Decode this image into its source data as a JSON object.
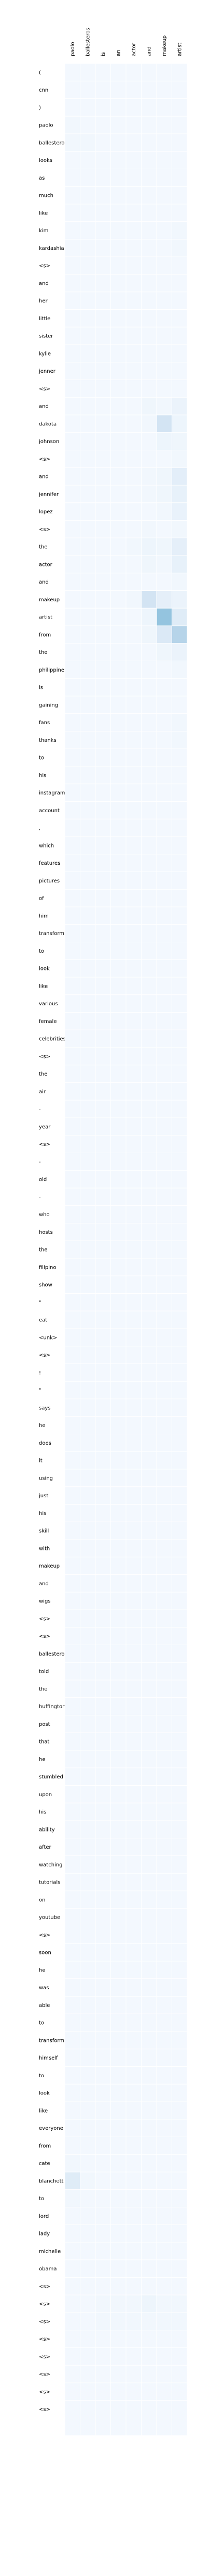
{
  "chart_data": {
    "type": "heatmap",
    "title": "",
    "xlabel": "",
    "ylabel": "",
    "x_labels": [
      "paolo",
      "ballesteros",
      "is",
      "an",
      "actor",
      "and",
      "makeup",
      "artist"
    ],
    "y_labels": [
      "(",
      "cnn",
      ")",
      "paolo",
      "ballesteros",
      "looks",
      "as",
      "much",
      "like",
      "kim",
      "kardashian",
      "<s>",
      "and",
      "her",
      "little",
      "sister",
      "kylie",
      "jenner",
      "<s>",
      "and",
      "dakota",
      "johnson",
      "<s>",
      "and",
      "jennifer",
      "lopez",
      "<s>",
      "the",
      "actor",
      "and",
      "makeup",
      "artist",
      "from",
      "the",
      "philippines",
      "is",
      "gaining",
      "fans",
      "thanks",
      "to",
      "his",
      "instagram",
      "account",
      ",",
      "which",
      "features",
      "pictures",
      "of",
      "him",
      "transformed",
      "to",
      "look",
      "like",
      "various",
      "female",
      "celebrities",
      "<s>",
      "the",
      "air",
      "-",
      "year",
      "<s>",
      "-",
      "old",
      "-",
      "who",
      "hosts",
      "the",
      "filipino",
      "show",
      "\"",
      "eat",
      "<unk>",
      "<s>",
      "!",
      "\"",
      "says",
      "he",
      "does",
      "it",
      "using",
      "just",
      "his",
      "skill",
      "with",
      "makeup",
      "and",
      "wigs",
      "<s>",
      "<s>",
      "ballesteros",
      "told",
      "the",
      "huffington",
      "post",
      "that",
      "he",
      "stumbled",
      "upon",
      "his",
      "ability",
      "after",
      "watching",
      "tutorials",
      "on",
      "youtube",
      "<s>",
      "soon",
      "he",
      "was",
      "able",
      "to",
      "transform",
      "himself",
      "to",
      "look",
      "like",
      "everyone",
      "from",
      "cate",
      "blanchett",
      "to",
      "lord",
      "lady",
      "michelle",
      "obama",
      "<s>",
      "<s>",
      "<s>",
      "<s>",
      "<s>",
      "<s>",
      "<s>",
      "<s>"
    ],
    "values": [
      [
        0.02,
        0.02,
        0.02,
        0.02,
        0.02,
        0.02,
        0.02,
        0.02
      ],
      [
        0.02,
        0.02,
        0.02,
        0.02,
        0.02,
        0.02,
        0.02,
        0.02
      ],
      [
        0.02,
        0.02,
        0.02,
        0.02,
        0.02,
        0.02,
        0.02,
        0.02
      ],
      [
        0.03,
        0.02,
        0.02,
        0.02,
        0.02,
        0.02,
        0.02,
        0.02
      ],
      [
        0.03,
        0.03,
        0.02,
        0.02,
        0.02,
        0.02,
        0.02,
        0.02
      ],
      [
        0.02,
        0.02,
        0.02,
        0.02,
        0.02,
        0.02,
        0.02,
        0.02
      ],
      [
        0.02,
        0.02,
        0.02,
        0.02,
        0.02,
        0.02,
        0.02,
        0.02
      ],
      [
        0.02,
        0.02,
        0.02,
        0.02,
        0.02,
        0.02,
        0.02,
        0.02
      ],
      [
        0.02,
        0.02,
        0.02,
        0.02,
        0.02,
        0.02,
        0.02,
        0.02
      ],
      [
        0.02,
        0.02,
        0.02,
        0.02,
        0.02,
        0.02,
        0.02,
        0.03
      ],
      [
        0.02,
        0.02,
        0.02,
        0.02,
        0.02,
        0.02,
        0.02,
        0.03
      ],
      [
        0.02,
        0.02,
        0.02,
        0.02,
        0.02,
        0.02,
        0.02,
        0.02
      ],
      [
        0.02,
        0.02,
        0.02,
        0.02,
        0.02,
        0.02,
        0.02,
        0.02
      ],
      [
        0.02,
        0.02,
        0.02,
        0.02,
        0.02,
        0.02,
        0.02,
        0.02
      ],
      [
        0.02,
        0.02,
        0.02,
        0.02,
        0.02,
        0.02,
        0.02,
        0.02
      ],
      [
        0.02,
        0.02,
        0.02,
        0.02,
        0.02,
        0.02,
        0.02,
        0.02
      ],
      [
        0.02,
        0.02,
        0.02,
        0.02,
        0.02,
        0.02,
        0.02,
        0.02
      ],
      [
        0.02,
        0.02,
        0.02,
        0.02,
        0.02,
        0.02,
        0.02,
        0.02
      ],
      [
        0.02,
        0.02,
        0.02,
        0.02,
        0.02,
        0.02,
        0.02,
        0.02
      ],
      [
        0.02,
        0.02,
        0.02,
        0.02,
        0.02,
        0.04,
        0.03,
        0.06
      ],
      [
        0.02,
        0.02,
        0.02,
        0.02,
        0.02,
        0.03,
        0.18,
        0.05
      ],
      [
        0.02,
        0.02,
        0.02,
        0.02,
        0.02,
        0.02,
        0.05,
        0.04
      ],
      [
        0.02,
        0.02,
        0.02,
        0.02,
        0.02,
        0.02,
        0.02,
        0.03
      ],
      [
        0.02,
        0.02,
        0.02,
        0.02,
        0.02,
        0.03,
        0.04,
        0.1
      ],
      [
        0.02,
        0.02,
        0.02,
        0.02,
        0.02,
        0.03,
        0.04,
        0.08
      ],
      [
        0.02,
        0.02,
        0.02,
        0.02,
        0.02,
        0.02,
        0.03,
        0.07
      ],
      [
        0.02,
        0.02,
        0.02,
        0.02,
        0.02,
        0.03,
        0.02,
        0.03
      ],
      [
        0.02,
        0.02,
        0.02,
        0.02,
        0.03,
        0.05,
        0.04,
        0.09
      ],
      [
        0.02,
        0.02,
        0.02,
        0.02,
        0.02,
        0.04,
        0.03,
        0.08
      ],
      [
        0.02,
        0.02,
        0.02,
        0.02,
        0.02,
        0.02,
        0.02,
        0.03
      ],
      [
        0.02,
        0.02,
        0.02,
        0.02,
        0.03,
        0.18,
        0.09,
        0.06
      ],
      [
        0.02,
        0.02,
        0.02,
        0.02,
        0.02,
        0.05,
        0.4,
        0.12
      ],
      [
        0.02,
        0.02,
        0.02,
        0.02,
        0.02,
        0.04,
        0.14,
        0.3
      ],
      [
        0.02,
        0.02,
        0.02,
        0.02,
        0.02,
        0.02,
        0.04,
        0.06
      ],
      [
        0.02,
        0.02,
        0.02,
        0.02,
        0.02,
        0.02,
        0.02,
        0.03
      ],
      [
        0.02,
        0.02,
        0.02,
        0.02,
        0.02,
        0.02,
        0.02,
        0.02
      ],
      [
        0.02,
        0.02,
        0.02,
        0.02,
        0.02,
        0.02,
        0.02,
        0.02
      ],
      [
        0.02,
        0.02,
        0.02,
        0.02,
        0.02,
        0.02,
        0.02,
        0.03
      ],
      [
        0.02,
        0.02,
        0.02,
        0.02,
        0.02,
        0.02,
        0.02,
        0.03
      ],
      [
        0.02,
        0.02,
        0.02,
        0.02,
        0.02,
        0.02,
        0.02,
        0.02
      ],
      [
        0.02,
        0.02,
        0.02,
        0.02,
        0.02,
        0.02,
        0.02,
        0.02
      ],
      [
        0.02,
        0.02,
        0.02,
        0.02,
        0.02,
        0.02,
        0.02,
        0.02
      ],
      [
        0.02,
        0.02,
        0.02,
        0.02,
        0.02,
        0.02,
        0.02,
        0.02
      ],
      [
        0.02,
        0.02,
        0.02,
        0.02,
        0.02,
        0.02,
        0.02,
        0.02
      ],
      [
        0.02,
        0.02,
        0.02,
        0.02,
        0.02,
        0.02,
        0.02,
        0.02
      ],
      [
        0.02,
        0.02,
        0.02,
        0.02,
        0.02,
        0.02,
        0.02,
        0.02
      ],
      [
        0.02,
        0.02,
        0.02,
        0.02,
        0.02,
        0.02,
        0.02,
        0.02
      ],
      [
        0.02,
        0.02,
        0.02,
        0.02,
        0.02,
        0.02,
        0.02,
        0.02
      ],
      [
        0.02,
        0.02,
        0.02,
        0.02,
        0.02,
        0.02,
        0.02,
        0.02
      ],
      [
        0.02,
        0.02,
        0.02,
        0.02,
        0.02,
        0.02,
        0.02,
        0.02
      ],
      [
        0.02,
        0.02,
        0.02,
        0.02,
        0.02,
        0.02,
        0.02,
        0.02
      ],
      [
        0.02,
        0.02,
        0.02,
        0.02,
        0.02,
        0.02,
        0.02,
        0.02
      ],
      [
        0.02,
        0.02,
        0.02,
        0.02,
        0.02,
        0.02,
        0.02,
        0.02
      ],
      [
        0.02,
        0.02,
        0.02,
        0.02,
        0.02,
        0.02,
        0.02,
        0.02
      ],
      [
        0.02,
        0.02,
        0.02,
        0.02,
        0.02,
        0.02,
        0.02,
        0.02
      ],
      [
        0.02,
        0.02,
        0.02,
        0.02,
        0.02,
        0.02,
        0.02,
        0.02
      ],
      [
        0.02,
        0.02,
        0.02,
        0.02,
        0.02,
        0.02,
        0.02,
        0.02
      ],
      [
        0.02,
        0.02,
        0.02,
        0.02,
        0.02,
        0.02,
        0.02,
        0.02
      ],
      [
        0.02,
        0.02,
        0.02,
        0.02,
        0.02,
        0.02,
        0.02,
        0.02
      ],
      [
        0.02,
        0.02,
        0.02,
        0.02,
        0.02,
        0.02,
        0.02,
        0.02
      ],
      [
        0.02,
        0.02,
        0.02,
        0.02,
        0.02,
        0.02,
        0.02,
        0.02
      ],
      [
        0.02,
        0.02,
        0.02,
        0.02,
        0.02,
        0.02,
        0.02,
        0.02
      ],
      [
        0.02,
        0.02,
        0.02,
        0.02,
        0.02,
        0.02,
        0.02,
        0.02
      ],
      [
        0.02,
        0.02,
        0.02,
        0.02,
        0.02,
        0.02,
        0.02,
        0.02
      ],
      [
        0.02,
        0.02,
        0.02,
        0.02,
        0.02,
        0.02,
        0.02,
        0.02
      ],
      [
        0.02,
        0.02,
        0.02,
        0.02,
        0.02,
        0.02,
        0.02,
        0.02
      ],
      [
        0.02,
        0.02,
        0.02,
        0.02,
        0.02,
        0.02,
        0.02,
        0.02
      ],
      [
        0.02,
        0.02,
        0.02,
        0.02,
        0.02,
        0.02,
        0.02,
        0.02
      ],
      [
        0.02,
        0.02,
        0.02,
        0.02,
        0.02,
        0.02,
        0.02,
        0.02
      ],
      [
        0.02,
        0.02,
        0.02,
        0.02,
        0.02,
        0.02,
        0.02,
        0.02
      ],
      [
        0.02,
        0.02,
        0.02,
        0.02,
        0.02,
        0.02,
        0.02,
        0.02
      ],
      [
        0.02,
        0.02,
        0.02,
        0.02,
        0.02,
        0.02,
        0.02,
        0.02
      ],
      [
        0.02,
        0.02,
        0.02,
        0.02,
        0.02,
        0.02,
        0.02,
        0.02
      ],
      [
        0.02,
        0.02,
        0.02,
        0.02,
        0.02,
        0.02,
        0.02,
        0.02
      ],
      [
        0.02,
        0.02,
        0.02,
        0.02,
        0.02,
        0.02,
        0.02,
        0.02
      ],
      [
        0.02,
        0.02,
        0.02,
        0.02,
        0.02,
        0.02,
        0.02,
        0.02
      ],
      [
        0.02,
        0.02,
        0.02,
        0.02,
        0.02,
        0.02,
        0.02,
        0.02
      ],
      [
        0.02,
        0.02,
        0.02,
        0.02,
        0.02,
        0.02,
        0.02,
        0.02
      ],
      [
        0.02,
        0.02,
        0.02,
        0.02,
        0.02,
        0.02,
        0.02,
        0.02
      ],
      [
        0.02,
        0.02,
        0.02,
        0.02,
        0.02,
        0.02,
        0.02,
        0.02
      ],
      [
        0.02,
        0.02,
        0.02,
        0.02,
        0.02,
        0.02,
        0.02,
        0.02
      ],
      [
        0.02,
        0.02,
        0.02,
        0.02,
        0.02,
        0.02,
        0.02,
        0.02
      ],
      [
        0.02,
        0.02,
        0.02,
        0.02,
        0.02,
        0.02,
        0.02,
        0.02
      ],
      [
        0.02,
        0.02,
        0.02,
        0.02,
        0.02,
        0.02,
        0.02,
        0.02
      ],
      [
        0.02,
        0.02,
        0.02,
        0.02,
        0.02,
        0.02,
        0.02,
        0.02
      ],
      [
        0.02,
        0.02,
        0.02,
        0.02,
        0.02,
        0.02,
        0.02,
        0.02
      ],
      [
        0.02,
        0.02,
        0.02,
        0.02,
        0.02,
        0.02,
        0.02,
        0.02
      ],
      [
        0.02,
        0.02,
        0.02,
        0.02,
        0.02,
        0.02,
        0.02,
        0.02
      ],
      [
        0.02,
        0.02,
        0.02,
        0.02,
        0.02,
        0.02,
        0.02,
        0.02
      ],
      [
        0.02,
        0.02,
        0.02,
        0.02,
        0.02,
        0.02,
        0.02,
        0.02
      ],
      [
        0.02,
        0.02,
        0.02,
        0.02,
        0.02,
        0.02,
        0.02,
        0.02
      ],
      [
        0.02,
        0.02,
        0.02,
        0.02,
        0.02,
        0.02,
        0.02,
        0.02
      ],
      [
        0.02,
        0.02,
        0.02,
        0.02,
        0.02,
        0.02,
        0.02,
        0.02
      ],
      [
        0.02,
        0.02,
        0.02,
        0.02,
        0.02,
        0.02,
        0.02,
        0.02
      ],
      [
        0.02,
        0.02,
        0.02,
        0.02,
        0.02,
        0.02,
        0.02,
        0.02
      ],
      [
        0.02,
        0.02,
        0.02,
        0.02,
        0.02,
        0.02,
        0.02,
        0.02
      ],
      [
        0.02,
        0.02,
        0.02,
        0.02,
        0.02,
        0.02,
        0.02,
        0.02
      ],
      [
        0.02,
        0.02,
        0.02,
        0.02,
        0.02,
        0.02,
        0.02,
        0.02
      ],
      [
        0.02,
        0.02,
        0.02,
        0.02,
        0.02,
        0.02,
        0.02,
        0.02
      ],
      [
        0.02,
        0.02,
        0.02,
        0.02,
        0.02,
        0.02,
        0.02,
        0.02
      ],
      [
        0.02,
        0.02,
        0.02,
        0.02,
        0.02,
        0.02,
        0.02,
        0.02
      ],
      [
        0.02,
        0.02,
        0.02,
        0.02,
        0.02,
        0.02,
        0.02,
        0.02
      ],
      [
        0.02,
        0.02,
        0.02,
        0.02,
        0.02,
        0.02,
        0.02,
        0.02
      ],
      [
        0.02,
        0.02,
        0.02,
        0.02,
        0.02,
        0.02,
        0.02,
        0.02
      ],
      [
        0.02,
        0.02,
        0.02,
        0.02,
        0.02,
        0.02,
        0.02,
        0.02
      ],
      [
        0.02,
        0.02,
        0.02,
        0.02,
        0.02,
        0.02,
        0.02,
        0.02
      ],
      [
        0.02,
        0.02,
        0.02,
        0.02,
        0.02,
        0.02,
        0.02,
        0.02
      ],
      [
        0.02,
        0.02,
        0.02,
        0.02,
        0.02,
        0.02,
        0.02,
        0.02
      ],
      [
        0.02,
        0.02,
        0.02,
        0.02,
        0.02,
        0.02,
        0.02,
        0.02
      ],
      [
        0.02,
        0.02,
        0.02,
        0.02,
        0.02,
        0.02,
        0.02,
        0.02
      ],
      [
        0.02,
        0.02,
        0.02,
        0.02,
        0.02,
        0.02,
        0.02,
        0.02
      ],
      [
        0.02,
        0.02,
        0.02,
        0.02,
        0.02,
        0.02,
        0.02,
        0.02
      ],
      [
        0.02,
        0.02,
        0.02,
        0.02,
        0.02,
        0.02,
        0.02,
        0.02
      ],
      [
        0.02,
        0.02,
        0.02,
        0.02,
        0.02,
        0.02,
        0.02,
        0.02
      ],
      [
        0.02,
        0.02,
        0.02,
        0.02,
        0.02,
        0.02,
        0.02,
        0.02
      ],
      [
        0.02,
        0.02,
        0.02,
        0.02,
        0.02,
        0.02,
        0.02,
        0.02
      ],
      [
        0.02,
        0.02,
        0.02,
        0.02,
        0.02,
        0.02,
        0.02,
        0.02
      ],
      [
        0.02,
        0.02,
        0.02,
        0.02,
        0.02,
        0.02,
        0.02,
        0.02
      ],
      [
        0.02,
        0.02,
        0.02,
        0.02,
        0.02,
        0.02,
        0.02,
        0.02
      ],
      [
        0.03,
        0.02,
        0.02,
        0.02,
        0.02,
        0.02,
        0.02,
        0.02
      ],
      [
        0.12,
        0.03,
        0.02,
        0.02,
        0.02,
        0.02,
        0.02,
        0.02
      ],
      [
        0.03,
        0.02,
        0.02,
        0.02,
        0.02,
        0.02,
        0.02,
        0.02
      ],
      [
        0.02,
        0.02,
        0.02,
        0.02,
        0.02,
        0.02,
        0.02,
        0.02
      ],
      [
        0.02,
        0.02,
        0.02,
        0.02,
        0.02,
        0.02,
        0.02,
        0.02
      ],
      [
        0.02,
        0.02,
        0.02,
        0.02,
        0.02,
        0.02,
        0.02,
        0.02
      ],
      [
        0.02,
        0.02,
        0.02,
        0.02,
        0.02,
        0.02,
        0.02,
        0.02
      ],
      [
        0.02,
        0.02,
        0.02,
        0.02,
        0.02,
        0.02,
        0.02,
        0.02
      ],
      [
        0.02,
        0.02,
        0.03,
        0.03,
        0.03,
        0.05,
        0.03,
        0.03
      ],
      [
        0.02,
        0.02,
        0.03,
        0.03,
        0.03,
        0.03,
        0.03,
        0.03
      ],
      [
        0.02,
        0.02,
        0.02,
        0.02,
        0.02,
        0.02,
        0.02,
        0.02
      ],
      [
        0.02,
        0.02,
        0.02,
        0.02,
        0.02,
        0.02,
        0.02,
        0.02
      ],
      [
        0.02,
        0.02,
        0.02,
        0.02,
        0.02,
        0.02,
        0.02,
        0.02
      ],
      [
        0.02,
        0.02,
        0.02,
        0.02,
        0.02,
        0.02,
        0.02,
        0.02
      ],
      [
        0.02,
        0.02,
        0.02,
        0.02,
        0.02,
        0.02,
        0.02,
        0.02
      ],
      [
        0.02,
        0.02,
        0.02,
        0.02,
        0.02,
        0.02,
        0.02,
        0.02
      ]
    ],
    "vmin": 0,
    "vmax": 0.5,
    "colormap": [
      "#f7fbff",
      "#deebf7",
      "#c6dbef",
      "#9ecae1",
      "#6baed6"
    ],
    "grid": true,
    "cell_border_color": "#ffffff"
  }
}
